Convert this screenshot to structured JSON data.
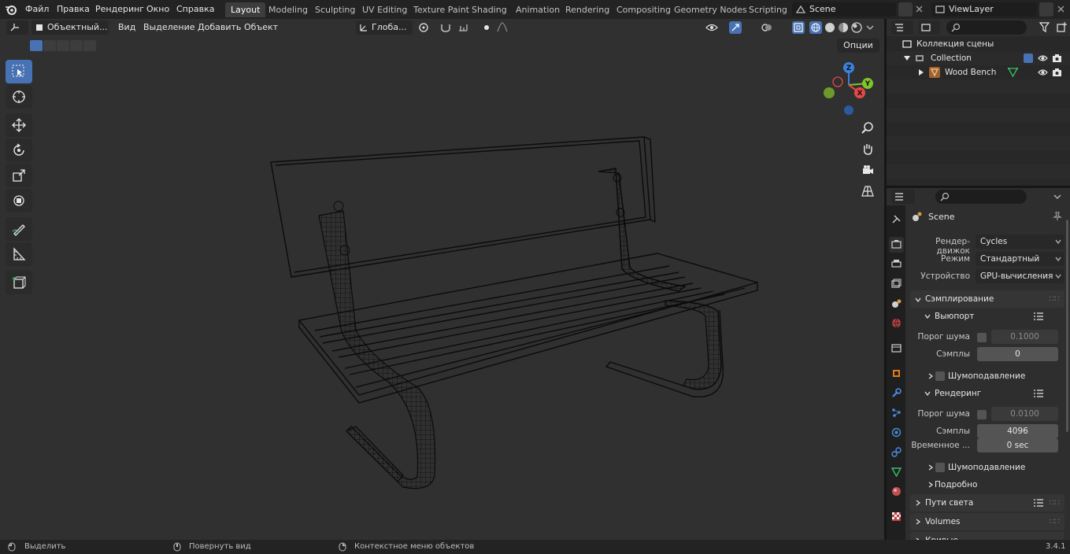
{
  "app": {
    "menu": [
      "Файл",
      "Правка",
      "Рендеринг",
      "Окно",
      "Справка"
    ],
    "workspaces": [
      "Layout",
      "Modeling",
      "Sculpting",
      "UV Editing",
      "Texture Paint",
      "Shading",
      "Animation",
      "Rendering",
      "Compositing",
      "Geometry Nodes",
      "Scripting"
    ],
    "active_workspace": "Layout",
    "scene_name": "Scene",
    "view_layer": "ViewLayer",
    "version": "3.4.1"
  },
  "viewport": {
    "mode": "Объектный...",
    "menus": [
      "Вид",
      "Выделение",
      "Добавить",
      "Объект"
    ],
    "transform_orientation": "Глоба...",
    "options_label": "Опции",
    "gizmo_axes": {
      "z": "Z",
      "y": "Y",
      "x": "X"
    }
  },
  "outliner": {
    "root": "Коллекция сцены",
    "collection": "Collection",
    "object": "Wood Bench"
  },
  "properties": {
    "context": "Scene",
    "render_engine_label": "Рендер-движок",
    "render_engine": "Cycles",
    "mode_label": "Режим",
    "mode": "Стандартный",
    "device_label": "Устройство",
    "device": "GPU-вычисления",
    "sampling": "Сэмплирование",
    "viewport_section": "Выюпорт",
    "noise_threshold_label": "Порог шума",
    "viewport_noise_threshold": "0.1000",
    "samples_label": "Сэмплы",
    "viewport_samples": "0",
    "denoise_label": "Шумоподавление",
    "render_section": "Рендеринг",
    "render_noise_threshold": "0.0100",
    "render_samples": "4096",
    "time_limit_label": "Временное ...",
    "time_limit": "0 sec",
    "advanced": "Подробно",
    "light_paths": "Пути света",
    "volumes": "Volumes",
    "curves": "Кривые"
  },
  "statusbar": {
    "select": "Выделить",
    "rotate_view": "Повернуть вид",
    "context_menu": "Контекстное меню объектов"
  },
  "colors": {
    "accent": "#4772b3",
    "viewport_bg": "#303030",
    "axis_x": "#e64848",
    "axis_y": "#7ec42a",
    "axis_z": "#3b82dd"
  }
}
